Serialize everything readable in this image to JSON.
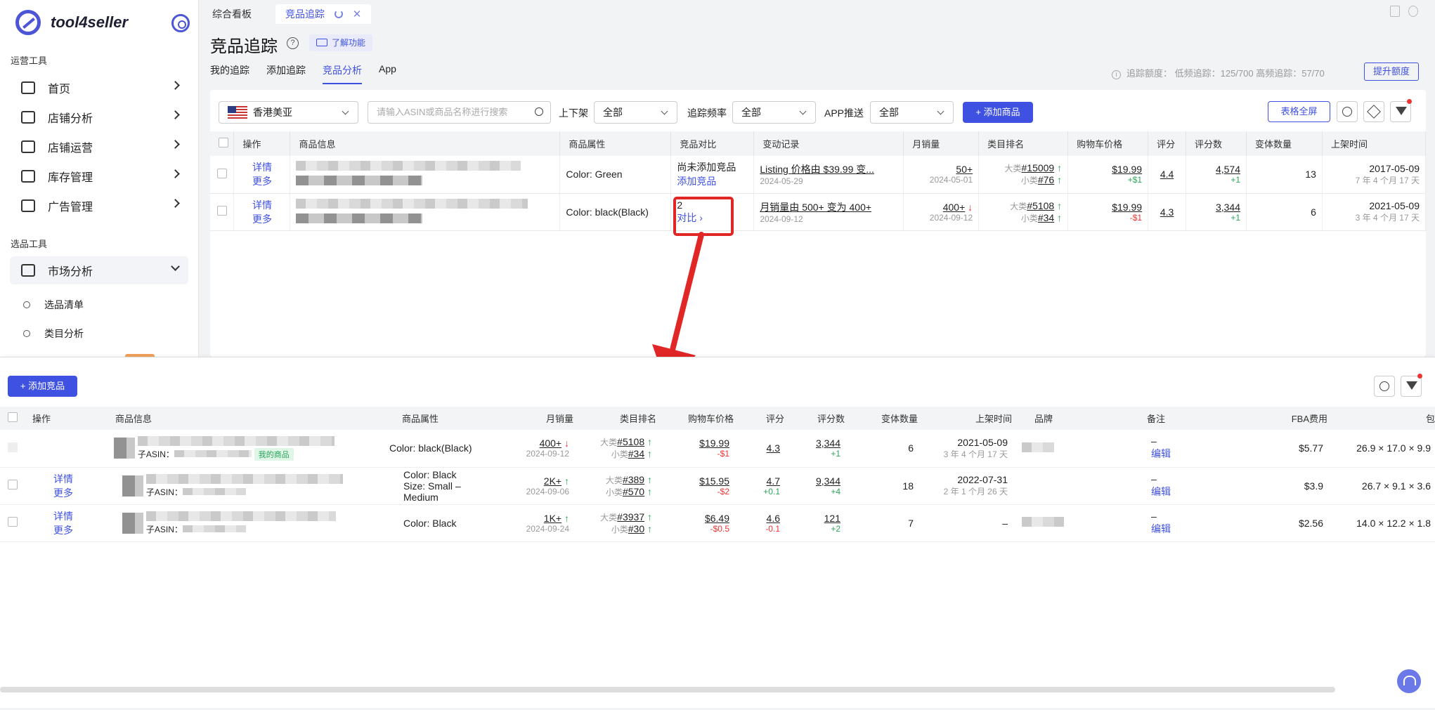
{
  "app": {
    "name": "tool4seller"
  },
  "sidebar": {
    "section_ops": "运营工具",
    "items": [
      {
        "label": "首页"
      },
      {
        "label": "店铺分析"
      },
      {
        "label": "店铺运营"
      },
      {
        "label": "库存管理"
      },
      {
        "label": "广告管理"
      }
    ],
    "section_select": "选品工具",
    "market": {
      "label": "市场分析"
    },
    "sub_items": [
      {
        "label": "选品清单"
      },
      {
        "label": "类目分析"
      }
    ]
  },
  "top_tabs": [
    {
      "label": "综合看板"
    },
    {
      "label": "竞品追踪"
    }
  ],
  "page": {
    "title": "竞品追踪",
    "help": "?",
    "learn": "了解功能",
    "subnav": [
      "我的追踪",
      "添加追踪",
      "竞品分析",
      "App"
    ],
    "quota": "追踪额度：  低频追踪：125/700  高频追踪：57/70",
    "raise": "提升额度"
  },
  "filters": {
    "marketplace": "香港美亚",
    "search_placeholder": "请输入ASIN或商品名称进行搜索",
    "listing_label": "上下架",
    "listing_value": "全部",
    "freq_label": "追踪频率",
    "freq_value": "全部",
    "push_label": "APP推送",
    "push_value": "全部",
    "add": "+ 添加商品",
    "fullscreen": "表格全屏"
  },
  "table1": {
    "headers": [
      "操作",
      "商品信息",
      "商品属性",
      "竞品对比",
      "变动记录",
      "月销量",
      "类目排名",
      "购物车价格",
      "评分",
      "评分数",
      "变体数量",
      "上架时间"
    ],
    "rows": [
      {
        "detail": "详情",
        "more": "更多",
        "attr": "Color: Green",
        "compare_main": "尚未添加竞品",
        "compare_link": "添加竞品",
        "change": "Listing 价格由 $39.99 变...",
        "change_date": "2024-05-29",
        "sales": "50+",
        "sales_date": "2024-05-01",
        "rank_big_label": "大类",
        "rank_big": "#15009",
        "rank_small_label": "小类",
        "rank_small": "#76",
        "price": "$19.99",
        "price_delta": "+$1",
        "rating": "4.4",
        "reviews": "4,574",
        "reviews_delta": "+1",
        "variants": "13",
        "listed": "2017-05-09",
        "listed_ago": "7 年 4 个月 17 天"
      },
      {
        "detail": "详情",
        "more": "更多",
        "attr": "Color: black(Black)",
        "compare_main": "2",
        "compare_link": "对比",
        "change": "月销量由 500+ 变为 400+",
        "change_date": "2024-09-12",
        "sales": "400+",
        "sales_date": "2024-09-12",
        "rank_big_label": "大类",
        "rank_big": "#5108",
        "rank_small_label": "小类",
        "rank_small": "#34",
        "price": "$19.99",
        "price_delta": "-$1",
        "rating": "4.3",
        "reviews": "3,344",
        "reviews_delta": "+1",
        "variants": "6",
        "listed": "2021-05-09",
        "listed_ago": "3 年 4 个月 17 天"
      }
    ]
  },
  "panel": {
    "add": "+ 添加竞品",
    "headers": [
      "操作",
      "商品信息",
      "商品属性",
      "月销量",
      "类目排名",
      "购物车价格",
      "评分",
      "评分数",
      "变体数量",
      "上架时间",
      "品牌",
      "备注",
      "FBA费用",
      "包"
    ],
    "rows": [
      {
        "detail": "",
        "more": "",
        "child_asin": "子ASIN：",
        "tag": "我的商品",
        "attr1": "Color: black(Black)",
        "attr2": "",
        "sales": "400+",
        "sales_date": "2024-09-12",
        "rank_big": "#5108",
        "rank_small": "#34",
        "price": "$19.99",
        "price_delta": "-$1",
        "rating": "4.3",
        "rating_delta": "",
        "reviews": "3,344",
        "reviews_delta": "+1",
        "variants": "6",
        "listed": "2021-05-09",
        "listed_ago": "3 年 4 个月 17 天",
        "note": "–",
        "edit": "编辑",
        "fba": "$5.77",
        "dims": "26.9 × 17.0 × 9.9"
      },
      {
        "detail": "详情",
        "more": "更多",
        "child_asin": "子ASIN：",
        "tag": "",
        "attr1": "Color: Black",
        "attr2": "Size: Small – Medium",
        "sales": "2K+",
        "sales_date": "2024-09-06",
        "rank_big": "#389",
        "rank_small": "#570",
        "price": "$15.95",
        "price_delta": "-$2",
        "rating": "4.7",
        "rating_delta": "+0.1",
        "reviews": "9,344",
        "reviews_delta": "+4",
        "variants": "18",
        "listed": "2022-07-31",
        "listed_ago": "2 年 1 个月 26 天",
        "note": "–",
        "edit": "编辑",
        "fba": "$3.9",
        "dims": "26.7 × 9.1 × 3.6"
      },
      {
        "detail": "详情",
        "more": "更多",
        "child_asin": "子ASIN：",
        "tag": "",
        "attr1": "Color: Black",
        "attr2": "",
        "sales": "1K+",
        "sales_date": "2024-09-24",
        "rank_big": "#3937",
        "rank_small": "#30",
        "price": "$6.49",
        "price_delta": "-$0.5",
        "rating": "4.6",
        "rating_delta": "-0.1",
        "reviews": "121",
        "reviews_delta": "+2",
        "variants": "7",
        "listed": "–",
        "listed_ago": "",
        "note": "–",
        "edit": "编辑",
        "fba": "$2.56",
        "dims": "14.0 × 12.2 × 1.8"
      }
    ],
    "rank_big_label": "大类",
    "rank_small_label": "小类"
  },
  "colors": {
    "accent": "#3f51e0",
    "highlight": "#e12626",
    "up": "#2aa65a",
    "down": "#e33333"
  }
}
